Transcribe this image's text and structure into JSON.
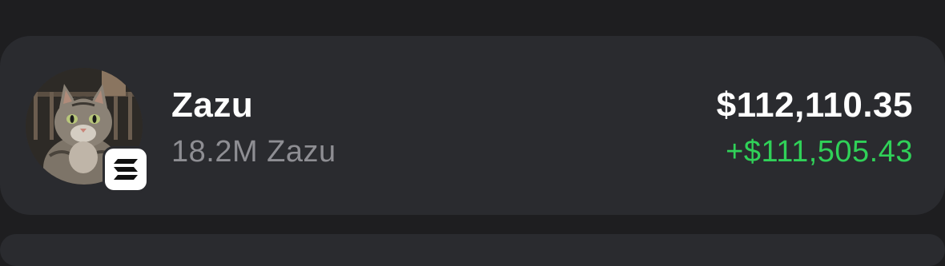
{
  "asset_row": {
    "name": "Zazu",
    "balance": "18.2M Zazu",
    "usd_value": "$112,110.35",
    "usd_change": "+$111,505.43",
    "avatar_icon": "cat-photo-avatar",
    "chain_icon": "solana-icon",
    "change_color": "#30d158"
  }
}
